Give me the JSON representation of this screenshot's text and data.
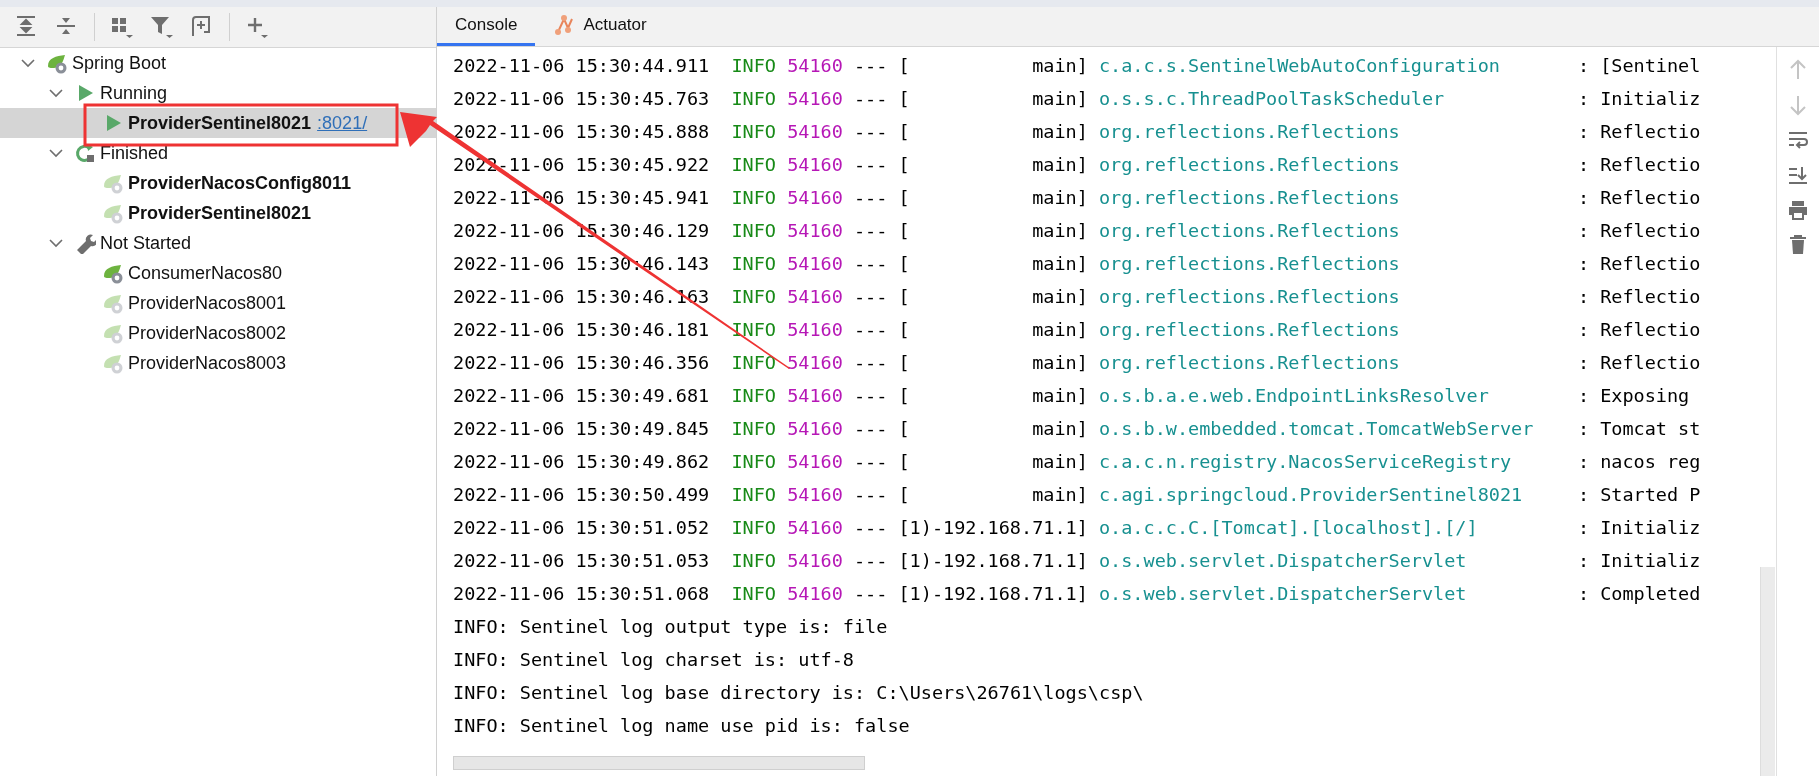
{
  "tree": [
    {
      "label": "Spring Boot",
      "kind": "root",
      "expanded": true,
      "selected": false,
      "children": [
        {
          "label": "Running",
          "kind": "running",
          "expanded": true,
          "selected": false,
          "children": [
            {
              "label": "ProviderSentinel8021",
              "kind": "app-running",
              "bold": true,
              "selected": true,
              "link": ":8021/"
            }
          ]
        },
        {
          "label": "Finished",
          "kind": "finished",
          "expanded": true,
          "selected": false,
          "children": [
            {
              "label": "ProviderNacosConfig8011",
              "kind": "app",
              "bold": true,
              "dimmed": true,
              "selected": false
            },
            {
              "label": "ProviderSentinel8021",
              "kind": "app",
              "bold": true,
              "dimmed": true,
              "selected": false
            }
          ]
        },
        {
          "label": "Not Started",
          "kind": "not-started",
          "expanded": true,
          "selected": false,
          "children": [
            {
              "label": "ConsumerNacos80",
              "kind": "app",
              "bold": false,
              "dimmed": false,
              "selected": false
            },
            {
              "label": "ProviderNacos8001",
              "kind": "app",
              "bold": false,
              "dimmed": true,
              "selected": false
            },
            {
              "label": "ProviderNacos8002",
              "kind": "app",
              "bold": false,
              "dimmed": true,
              "selected": false
            },
            {
              "label": "ProviderNacos8003",
              "kind": "app",
              "bold": false,
              "dimmed": true,
              "selected": false
            }
          ]
        }
      ]
    }
  ],
  "tabs": [
    {
      "label": "Console",
      "kind": "console",
      "selected": true
    },
    {
      "label": "Actuator",
      "kind": "actuator",
      "selected": false
    }
  ],
  "log": [
    {
      "kind": "spring",
      "time": "2022-11-06 15:30:44.911",
      "level": "INFO",
      "pid": "54160",
      "sep": "---",
      "thread": "[           main]",
      "logger": "c.a.c.s.SentinelWebAutoConfiguration",
      "message": ": [Sentinel"
    },
    {
      "kind": "spring",
      "time": "2022-11-06 15:30:45.763",
      "level": "INFO",
      "pid": "54160",
      "sep": "---",
      "thread": "[           main]",
      "logger": "o.s.s.c.ThreadPoolTaskScheduler",
      "message": ": Initializ"
    },
    {
      "kind": "spring",
      "time": "2022-11-06 15:30:45.888",
      "level": "INFO",
      "pid": "54160",
      "sep": "---",
      "thread": "[           main]",
      "logger": "org.reflections.Reflections",
      "message": ": Reflectio"
    },
    {
      "kind": "spring",
      "time": "2022-11-06 15:30:45.922",
      "level": "INFO",
      "pid": "54160",
      "sep": "---",
      "thread": "[           main]",
      "logger": "org.reflections.Reflections",
      "message": ": Reflectio"
    },
    {
      "kind": "spring",
      "time": "2022-11-06 15:30:45.941",
      "level": "INFO",
      "pid": "54160",
      "sep": "---",
      "thread": "[           main]",
      "logger": "org.reflections.Reflections",
      "message": ": Reflectio"
    },
    {
      "kind": "spring",
      "time": "2022-11-06 15:30:46.129",
      "level": "INFO",
      "pid": "54160",
      "sep": "---",
      "thread": "[           main]",
      "logger": "org.reflections.Reflections",
      "message": ": Reflectio"
    },
    {
      "kind": "spring",
      "time": "2022-11-06 15:30:46.143",
      "level": "INFO",
      "pid": "54160",
      "sep": "---",
      "thread": "[           main]",
      "logger": "org.reflections.Reflections",
      "message": ": Reflectio"
    },
    {
      "kind": "spring",
      "time": "2022-11-06 15:30:46.163",
      "level": "INFO",
      "pid": "54160",
      "sep": "---",
      "thread": "[           main]",
      "logger": "org.reflections.Reflections",
      "message": ": Reflectio"
    },
    {
      "kind": "spring",
      "time": "2022-11-06 15:30:46.181",
      "level": "INFO",
      "pid": "54160",
      "sep": "---",
      "thread": "[           main]",
      "logger": "org.reflections.Reflections",
      "message": ": Reflectio"
    },
    {
      "kind": "spring",
      "time": "2022-11-06 15:30:46.356",
      "level": "INFO",
      "pid": "54160",
      "sep": "---",
      "thread": "[           main]",
      "logger": "org.reflections.Reflections",
      "message": ": Reflectio"
    },
    {
      "kind": "spring",
      "time": "2022-11-06 15:30:49.681",
      "level": "INFO",
      "pid": "54160",
      "sep": "---",
      "thread": "[           main]",
      "logger": "o.s.b.a.e.web.EndpointLinksResolver",
      "message": ": Exposing"
    },
    {
      "kind": "spring",
      "time": "2022-11-06 15:30:49.845",
      "level": "INFO",
      "pid": "54160",
      "sep": "---",
      "thread": "[           main]",
      "logger": "o.s.b.w.embedded.tomcat.TomcatWebServer",
      "message": ": Tomcat st"
    },
    {
      "kind": "spring",
      "time": "2022-11-06 15:30:49.862",
      "level": "INFO",
      "pid": "54160",
      "sep": "---",
      "thread": "[           main]",
      "logger": "c.a.c.n.registry.NacosServiceRegistry",
      "message": ": nacos reg"
    },
    {
      "kind": "spring",
      "time": "2022-11-06 15:30:50.499",
      "level": "INFO",
      "pid": "54160",
      "sep": "---",
      "thread": "[           main]",
      "logger": "c.agi.springcloud.ProviderSentinel8021",
      "message": ": Started P"
    },
    {
      "kind": "spring",
      "time": "2022-11-06 15:30:51.052",
      "level": "INFO",
      "pid": "54160",
      "sep": "---",
      "thread": "[1)-192.168.71.1]",
      "logger": "o.a.c.c.C.[Tomcat].[localhost].[/]",
      "message": ": Initializ"
    },
    {
      "kind": "spring",
      "time": "2022-11-06 15:30:51.053",
      "level": "INFO",
      "pid": "54160",
      "sep": "---",
      "thread": "[1)-192.168.71.1]",
      "logger": "o.s.web.servlet.DispatcherServlet",
      "message": ": Initializ"
    },
    {
      "kind": "spring",
      "time": "2022-11-06 15:30:51.068",
      "level": "INFO",
      "pid": "54160",
      "sep": "---",
      "thread": "[1)-192.168.71.1]",
      "logger": "o.s.web.servlet.DispatcherServlet",
      "message": ": Completed"
    },
    {
      "kind": "plain",
      "text": "INFO: Sentinel log output type is: file"
    },
    {
      "kind": "plain",
      "text": "INFO: Sentinel log charset is: utf-8"
    },
    {
      "kind": "plain",
      "text": "INFO: Sentinel log base directory is: C:\\Users\\26761\\logs\\csp\\"
    },
    {
      "kind": "plain",
      "text": "INFO: Sentinel log name use pid is: false"
    }
  ]
}
